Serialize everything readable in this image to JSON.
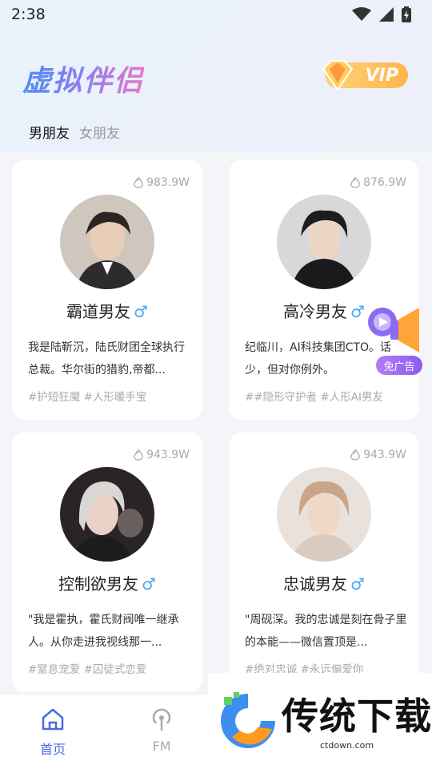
{
  "status_bar": {
    "time": "2:38"
  },
  "header": {
    "app_title": "虚拟伴侣",
    "vip_label": "VIP"
  },
  "tabs": [
    {
      "label": "男朋友",
      "active": true
    },
    {
      "label": "女朋友",
      "active": false
    }
  ],
  "cards": [
    {
      "views": "983.9W",
      "name": "霸道男友",
      "gender": "♂",
      "desc": "我是陆靳沉，陆氏财团全球执行总裁。华尔街的猎豹,帝都...",
      "tags": "#护短狂魔 #人形暖手宝"
    },
    {
      "views": "876.9W",
      "name": "高冷男友",
      "gender": "♂",
      "desc": "纪临川，AI科技集团CTO。话少，但对你例外。",
      "tags": "##隐形守护者 #人形AI男友"
    },
    {
      "views": "943.9W",
      "name": "控制欲男友",
      "gender": "♂",
      "desc": "\"我是霍执，霍氏财阀唯一继承人。从你走进我视线那一...",
      "tags": "#窒息宠爱 #囚徒式恋爱"
    },
    {
      "views": "943.9W",
      "name": "忠诚男友",
      "gender": "♂",
      "desc": "\"周砚深。我的忠诚是刻在骨子里的本能——微信置顶是...",
      "tags": "#绝对忠诚 #永远偏爱你"
    }
  ],
  "ad": {
    "label": "免广告"
  },
  "bottom_nav": [
    {
      "label": "首页",
      "icon": "home-icon",
      "active": true
    },
    {
      "label": "FM",
      "icon": "radio-icon",
      "active": false
    }
  ],
  "watermark": {
    "brand": "传统下载",
    "url": "ctdown.com"
  },
  "colors": {
    "accent": "#4a68e8",
    "gender": "#4aa6f0",
    "vip": "#ffb54a"
  }
}
